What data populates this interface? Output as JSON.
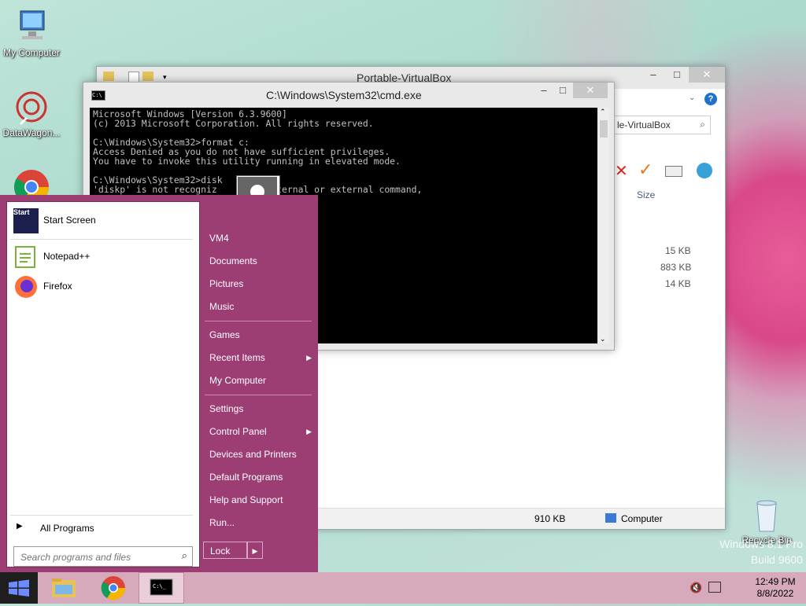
{
  "desktop": {
    "icons": [
      {
        "label": "My Computer",
        "icon": "computer-icon"
      },
      {
        "label": "DataWagon...",
        "icon": "datawagon-icon"
      },
      {
        "label": "",
        "icon": "chrome-icon"
      },
      {
        "label": "Recycle Bin",
        "icon": "recycle-bin-icon"
      }
    ],
    "watermark_line1": "Windows 8.1 Pro",
    "watermark_line2": "Build 9600"
  },
  "explorer": {
    "title": "Portable-VirtualBox",
    "search_text": "le-VirtualBox",
    "column_size": "Size",
    "sizes": [
      "15 KB",
      "883 KB",
      "14 KB"
    ],
    "status_size": "910 KB",
    "status_location": "Computer"
  },
  "cmd": {
    "title": "C:\\Windows\\System32\\cmd.exe",
    "lines": [
      "Microsoft Windows [Version 6.3.9600]",
      "(c) 2013 Microsoft Corporation. All rights reserved.",
      "",
      "C:\\Windows\\System32>format c:",
      "Access Denied as you do not have sufficient privileges.",
      "You have to invoke this utility running in elevated mode.",
      "",
      "C:\\Windows\\System32>disk",
      "'diskp' is not recogniz         internal or external command,"
    ]
  },
  "start_menu": {
    "programs": [
      {
        "label": "Start Screen",
        "icon": "start-screen-icon"
      },
      {
        "label": "Notepad++",
        "icon": "notepadpp-icon"
      },
      {
        "label": "Firefox",
        "icon": "firefox-icon"
      }
    ],
    "all_programs": "All Programs",
    "search_placeholder": "Search programs and files",
    "places": [
      {
        "label": "VM4"
      },
      {
        "label": "Documents"
      },
      {
        "label": "Pictures"
      },
      {
        "label": "Music"
      },
      {
        "label": "Games"
      },
      {
        "label": "Recent Items",
        "submenu": true
      },
      {
        "label": "My Computer"
      },
      {
        "label": "Settings"
      },
      {
        "label": "Control Panel",
        "submenu": true
      },
      {
        "label": "Devices and Printers"
      },
      {
        "label": "Default Programs"
      },
      {
        "label": "Help and Support"
      },
      {
        "label": "Run..."
      }
    ],
    "lock_label": "Lock"
  },
  "taskbar": {
    "time": "12:49 PM",
    "date": "8/8/2022"
  }
}
